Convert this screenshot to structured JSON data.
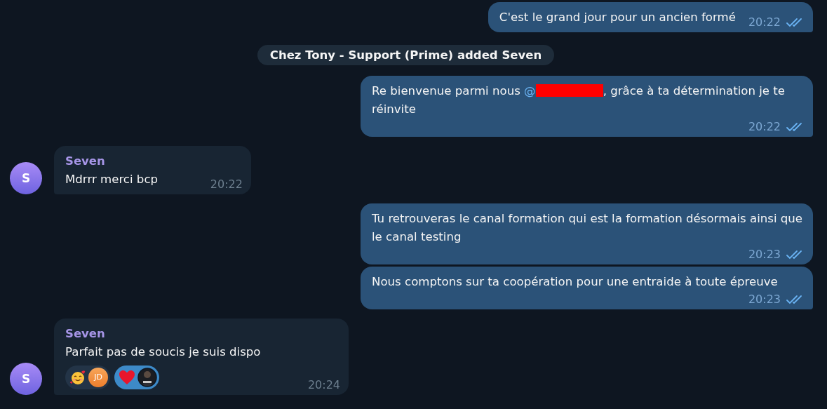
{
  "messages": [
    {
      "kind": "outgoing",
      "text": "C'est le grand jour pour un ancien formé",
      "time": "20:22",
      "read": true,
      "tail": true
    },
    {
      "kind": "service",
      "text": "Chez Tony - Support (Prime) added Seven"
    },
    {
      "kind": "outgoing",
      "text": "Re bienvenue parmi nous ",
      "mention": "@",
      "mention_redacted": true,
      "text_after": ", grâce à ta détermination je te réinvite",
      "time": "20:22",
      "read": true,
      "tail": true
    },
    {
      "kind": "incoming",
      "sender": "Seven",
      "avatar": "S",
      "text": "Mdrrr merci bcp",
      "time": "20:22",
      "tail": true
    },
    {
      "kind": "outgoing",
      "text": "Tu retrouveras le canal formation qui est la formation désormais ainsi que le canal testing",
      "time": "20:23",
      "read": true,
      "tail": false
    },
    {
      "kind": "outgoing",
      "text": "Nous comptons sur ta coopération pour une entraide à toute épreuve",
      "time": "20:23",
      "read": true,
      "tail": true
    },
    {
      "kind": "incoming",
      "sender": "Seven",
      "avatar": "S",
      "text": "Parfait pas de soucis je suis dispo",
      "time": "20:24",
      "tail": true,
      "reactions": [
        {
          "kind": "smiling-face",
          "selected": false,
          "user": {
            "kind": "initials",
            "text": "JD"
          }
        },
        {
          "kind": "heart",
          "selected": true
        }
      ]
    }
  ]
}
